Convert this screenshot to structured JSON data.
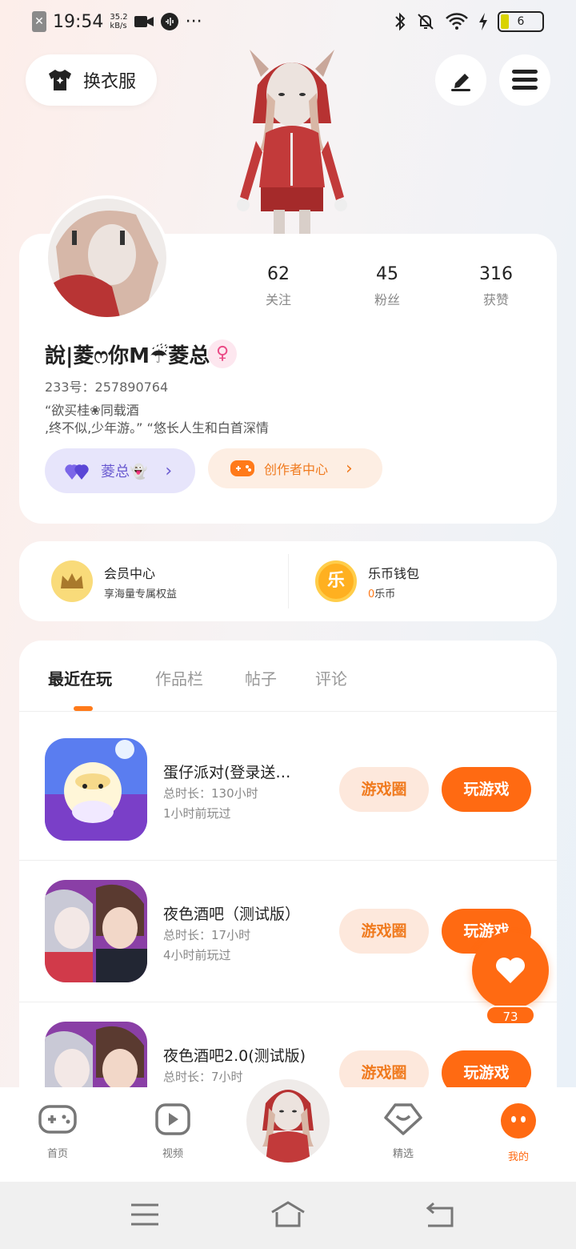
{
  "status_bar": {
    "time": "19:54",
    "net_speed_value": "35.2",
    "net_speed_unit": "kB/s",
    "more": "···",
    "battery": "6"
  },
  "header": {
    "outfit_label": "换衣服"
  },
  "profile": {
    "stats": [
      {
        "num": "62",
        "label": "关注"
      },
      {
        "num": "45",
        "label": "粉丝"
      },
      {
        "num": "316",
        "label": "获赞"
      }
    ],
    "nickname": "說|菱ෆ你M☔菱总",
    "gender_symbol": "♀",
    "uid_label": "233号：",
    "uid_value": "257890764",
    "bio_line1": "“欲买桂❀同载酒",
    "bio_line2": ",终不似,少年游。” “悠长人生和白首深情",
    "tag_left": "菱总👻",
    "tag_right": "创作者中心"
  },
  "wallet": {
    "vip_title": "会员中心",
    "vip_sub": "享海量专属权益",
    "coin_glyph": "乐",
    "coin_title": "乐币钱包",
    "coin_amount": "0",
    "coin_unit": "乐币"
  },
  "tabs": [
    "最近在玩",
    "作品栏",
    "帖子",
    "评论"
  ],
  "games": [
    {
      "title": "蛋仔派对(登录送…",
      "duration": "总时长：130小时",
      "last": "1小时前玩过"
    },
    {
      "title": "夜色酒吧（测试版）",
      "duration": "总时长：17小时",
      "last": "4小时前玩过"
    },
    {
      "title": "夜色酒吧2.0(测试版)",
      "duration": "总时长：7小时",
      "last": ""
    }
  ],
  "buttons": {
    "circle": "游戏圈",
    "play": "玩游戏"
  },
  "like_count": "73",
  "nav": {
    "home": "首页",
    "video": "视频",
    "featured": "精选",
    "mine": "我的"
  },
  "colors": {
    "accent": "#ff6a12",
    "purple": "#6a5ad0"
  }
}
